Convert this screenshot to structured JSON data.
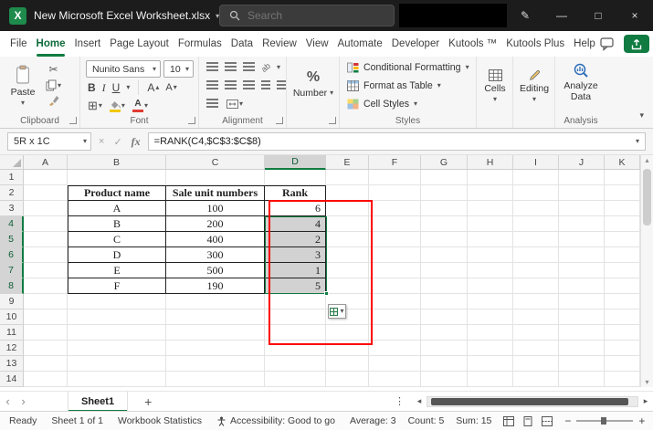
{
  "window": {
    "title": "New Microsoft Excel Worksheet.xlsx",
    "search_placeholder": "Search"
  },
  "menu": {
    "tabs": [
      {
        "label": "File",
        "active": false
      },
      {
        "label": "Home",
        "active": true
      },
      {
        "label": "Insert",
        "active": false
      },
      {
        "label": "Page Layout",
        "active": false
      },
      {
        "label": "Formulas",
        "active": false
      },
      {
        "label": "Data",
        "active": false
      },
      {
        "label": "Review",
        "active": false
      },
      {
        "label": "View",
        "active": false
      },
      {
        "label": "Automate",
        "active": false
      },
      {
        "label": "Developer",
        "active": false
      },
      {
        "label": "Kutools ™",
        "active": false
      },
      {
        "label": "Kutools Plus",
        "active": false
      },
      {
        "label": "Help",
        "active": false
      }
    ]
  },
  "ribbon": {
    "paste": "Paste",
    "clipboard_group": "Clipboard",
    "font_name": "Nunito Sans",
    "font_size": "10",
    "font_group": "Font",
    "alignment_group": "Alignment",
    "number_button": "Number",
    "conditional_formatting": "Conditional Formatting",
    "format_as_table": "Format as Table",
    "cell_styles": "Cell Styles",
    "styles_group": "Styles",
    "cells_button": "Cells",
    "editing_button": "Editing",
    "analyze_data": "Analyze Data",
    "analysis_group": "Analysis"
  },
  "formula_bar": {
    "name_box": "5R x 1C",
    "fx_label": "fx",
    "formula": "=RANK(C4,$C$3:$C$8)"
  },
  "grid": {
    "columns": [
      "A",
      "B",
      "C",
      "D",
      "E",
      "F",
      "G",
      "H",
      "I",
      "J",
      "K"
    ],
    "row_count": 14,
    "selected_range": "D4:D8",
    "selected_column": "D",
    "selected_row_start": 4,
    "selected_row_end": 8,
    "table": {
      "origin": "B2",
      "headers": [
        "Product name",
        "Sale unit numbers",
        "Rank"
      ],
      "rows": [
        [
          "A",
          "100",
          "6"
        ],
        [
          "B",
          "200",
          "4"
        ],
        [
          "C",
          "400",
          "2"
        ],
        [
          "D",
          "300",
          "3"
        ],
        [
          "E",
          "500",
          "1"
        ],
        [
          "F",
          "190",
          "5"
        ]
      ]
    }
  },
  "sheet_bar": {
    "active_tab": "Sheet1",
    "add_button": "+"
  },
  "status_bar": {
    "mode": "Ready",
    "sheet_info": "Sheet 1 of 1",
    "workbook_statistics": "Workbook Statistics",
    "accessibility": "Accessibility: Good to go",
    "average": "Average: 3",
    "count": "Count: 5",
    "sum": "Sum: 15",
    "zoom_out": "−",
    "zoom_in": "+"
  },
  "icons": {
    "excel_logo": "X",
    "chevron_down": "▾",
    "chevron_left": "‹",
    "chevron_right": "›",
    "scroll_left": "◂",
    "scroll_right": "▸",
    "scroll_up": "▴",
    "scroll_down": "▾",
    "dots_vertical": "⋮",
    "minimize": "—",
    "maximize": "□",
    "close": "×",
    "cut": "✂",
    "check": "✓",
    "cancel": "×",
    "borders": "⊞",
    "percent": "%",
    "bold": "B",
    "italic": "I",
    "underline": "U",
    "font_color_letter": "A",
    "grow_font_letter": "A",
    "shrink_font_letter": "A",
    "orientation_text": "ab",
    "pen": "✎"
  },
  "colors": {
    "accent": "#107C41",
    "selection_fill": "#d2d2d2",
    "annotation": "#FE0000",
    "titlebar": "#1C1C1C"
  }
}
